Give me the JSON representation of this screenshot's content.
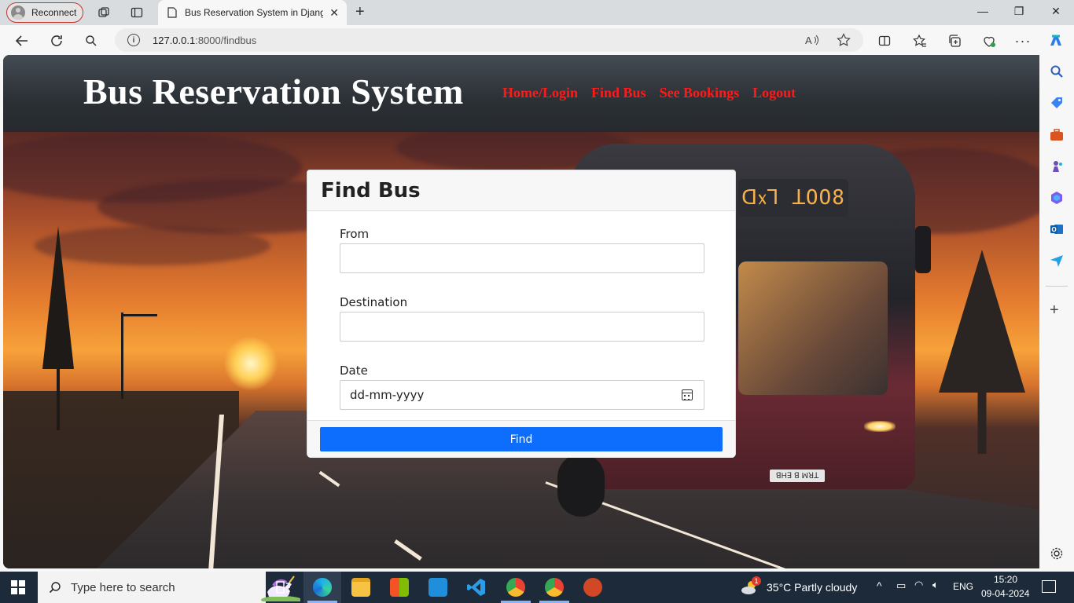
{
  "browser": {
    "profile_label": "Reconnect",
    "tab_title": "Bus Reservation System in Djang",
    "url_host": "127.0.0.1",
    "url_rest": ":8000/findbus"
  },
  "site": {
    "title": "Bus Reservation System",
    "nav": [
      "Home/Login",
      "Find Bus",
      "See Bookings",
      "Logout"
    ],
    "nav_color": "#ff1a1a"
  },
  "bus_scene": {
    "sign_text": "ᗡ᥊ꓶ ꓕOO8",
    "plate_text": "ꓭHꓱ ꓭ ꟽꓤꓕ"
  },
  "form": {
    "heading": "Find Bus",
    "from_label": "From",
    "from_value": "",
    "destination_label": "Destination",
    "destination_value": "",
    "date_label": "Date",
    "date_placeholder": "dd-mm-yyyy",
    "submit_label": "Find",
    "submit_color": "#0d6efd"
  },
  "taskbar": {
    "search_placeholder": "Type here to search",
    "weather": "35°C  Partly cloudy",
    "weather_badge": "1",
    "language": "ENG",
    "time": "15:20",
    "date": "09-04-2024"
  }
}
